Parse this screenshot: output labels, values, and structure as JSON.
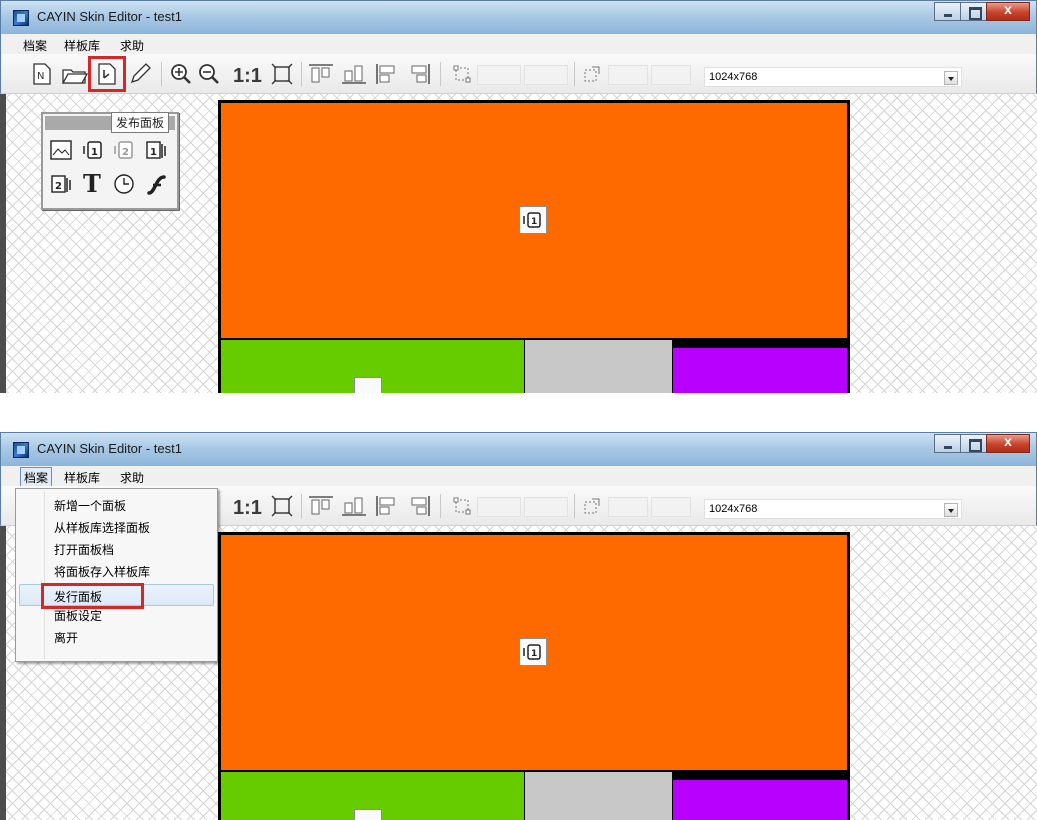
{
  "window": {
    "title": "CAYIN Skin Editor - test1",
    "buttons": [
      "minimize",
      "maximize",
      "close"
    ]
  },
  "menubar": {
    "items": [
      {
        "label": "档案"
      },
      {
        "label": "样板库"
      },
      {
        "label": "求助"
      }
    ]
  },
  "toolbar": {
    "icons": [
      "new-skin-icon",
      "open-folder-icon",
      "publish-icon",
      "pencil-icon",
      "zoom-in-icon",
      "zoom-out-icon",
      "fit-screen-icon",
      "align-top-icon",
      "align-bottom-icon",
      "align-left-icon",
      "align-right-icon",
      "select-icon",
      "resize-icon"
    ],
    "zoom_label": "1:1",
    "resolution": "1024x768"
  },
  "palette": {
    "tooltip": "发布面板",
    "tools": [
      "image-zone-icon",
      "video-zone-1-icon",
      "video-zone-2-icon",
      "media-zone-1-icon",
      "media-zone-2-icon",
      "text-zone-icon",
      "clock-zone-icon",
      "flash-zone-icon"
    ]
  },
  "file_menu": {
    "items": [
      {
        "label": "新增一个面板"
      },
      {
        "label": "从样板库选择面板"
      },
      {
        "label": "打开面板档"
      },
      {
        "label": "将面板存入样板库"
      },
      {
        "label": "发行面板"
      },
      {
        "label": "面板设定"
      },
      {
        "label": "离开"
      }
    ]
  },
  "layout_zones": [
    {
      "name": "video-zone-1",
      "color": "#ff6a00"
    },
    {
      "name": "media-zone-2",
      "color": "#66cc00"
    },
    {
      "name": "grey-zone",
      "color": "#c8c8c8"
    },
    {
      "name": "purple-zone",
      "color": "#b700ff"
    }
  ]
}
